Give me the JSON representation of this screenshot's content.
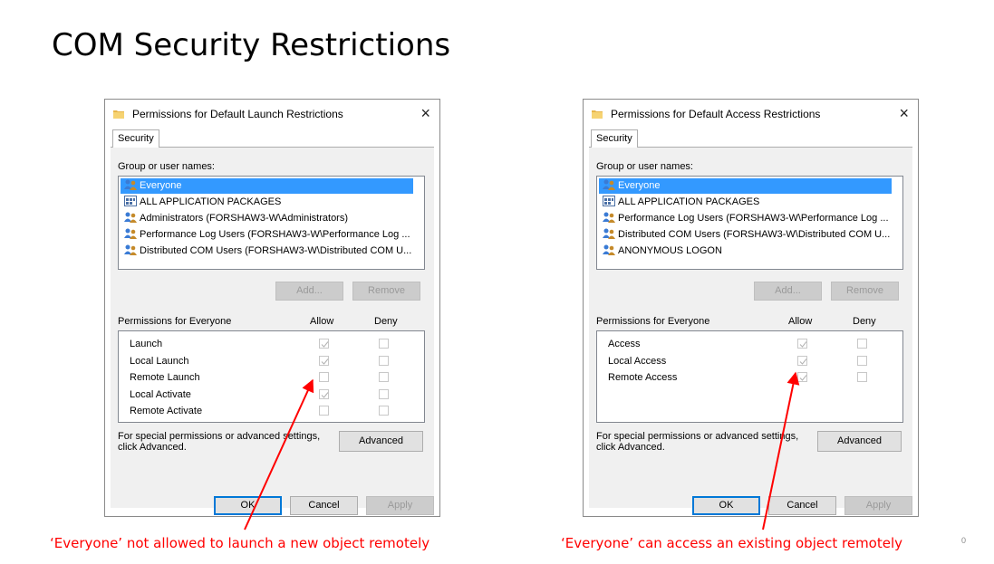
{
  "slide_title": "COM Security Restrictions",
  "page_number": "0",
  "colors": {
    "arrow": "#ff0000",
    "selection": "#3399ff"
  },
  "dialogs": [
    {
      "title": "Permissions for Default Launch Restrictions",
      "close_label": "×",
      "tab": "Security",
      "group_label": "Group or user names:",
      "users": [
        {
          "name": "Everyone",
          "icon": "users-icon",
          "selected": true
        },
        {
          "name": "ALL APPLICATION PACKAGES",
          "icon": "packages-icon",
          "selected": false
        },
        {
          "name": "Administrators (FORSHAW3-W\\Administrators)",
          "icon": "users-icon",
          "selected": false
        },
        {
          "name": "Performance Log Users (FORSHAW3-W\\Performance Log ...",
          "icon": "users-icon",
          "selected": false
        },
        {
          "name": "Distributed COM Users (FORSHAW3-W\\Distributed COM U...",
          "icon": "users-icon",
          "selected": false
        }
      ],
      "add_label": "Add...",
      "remove_label": "Remove",
      "perm_header": "Permissions for Everyone",
      "allow_header": "Allow",
      "deny_header": "Deny",
      "permissions": [
        {
          "name": "Launch",
          "allow": true,
          "deny": false
        },
        {
          "name": "Local Launch",
          "allow": true,
          "deny": false
        },
        {
          "name": "Remote Launch",
          "allow": false,
          "deny": false
        },
        {
          "name": "Local Activate",
          "allow": true,
          "deny": false
        },
        {
          "name": "Remote Activate",
          "allow": false,
          "deny": false
        }
      ],
      "special_text_1": "For special permissions or advanced settings,",
      "special_text_2": "click Advanced.",
      "advanced_label": "Advanced",
      "ok_label": "OK",
      "cancel_label": "Cancel",
      "apply_label": "Apply",
      "caption": "‘Everyone’ not allowed to launch a new object remotely"
    },
    {
      "title": "Permissions for Default Access Restrictions",
      "close_label": "×",
      "tab": "Security",
      "group_label": "Group or user names:",
      "users": [
        {
          "name": "Everyone",
          "icon": "users-icon",
          "selected": true
        },
        {
          "name": "ALL APPLICATION PACKAGES",
          "icon": "packages-icon",
          "selected": false
        },
        {
          "name": "Performance Log Users (FORSHAW3-W\\Performance Log ...",
          "icon": "users-icon",
          "selected": false
        },
        {
          "name": "Distributed COM Users (FORSHAW3-W\\Distributed COM U...",
          "icon": "users-icon",
          "selected": false
        },
        {
          "name": "ANONYMOUS LOGON",
          "icon": "users-icon",
          "selected": false
        }
      ],
      "add_label": "Add...",
      "remove_label": "Remove",
      "perm_header": "Permissions for Everyone",
      "allow_header": "Allow",
      "deny_header": "Deny",
      "permissions": [
        {
          "name": "Access",
          "allow": true,
          "deny": false
        },
        {
          "name": "Local Access",
          "allow": true,
          "deny": false
        },
        {
          "name": "Remote Access",
          "allow": true,
          "deny": false
        }
      ],
      "special_text_1": "For special permissions or advanced settings,",
      "special_text_2": "click Advanced.",
      "advanced_label": "Advanced",
      "ok_label": "OK",
      "cancel_label": "Cancel",
      "apply_label": "Apply",
      "caption": "‘Everyone’ can access an existing object remotely"
    }
  ]
}
